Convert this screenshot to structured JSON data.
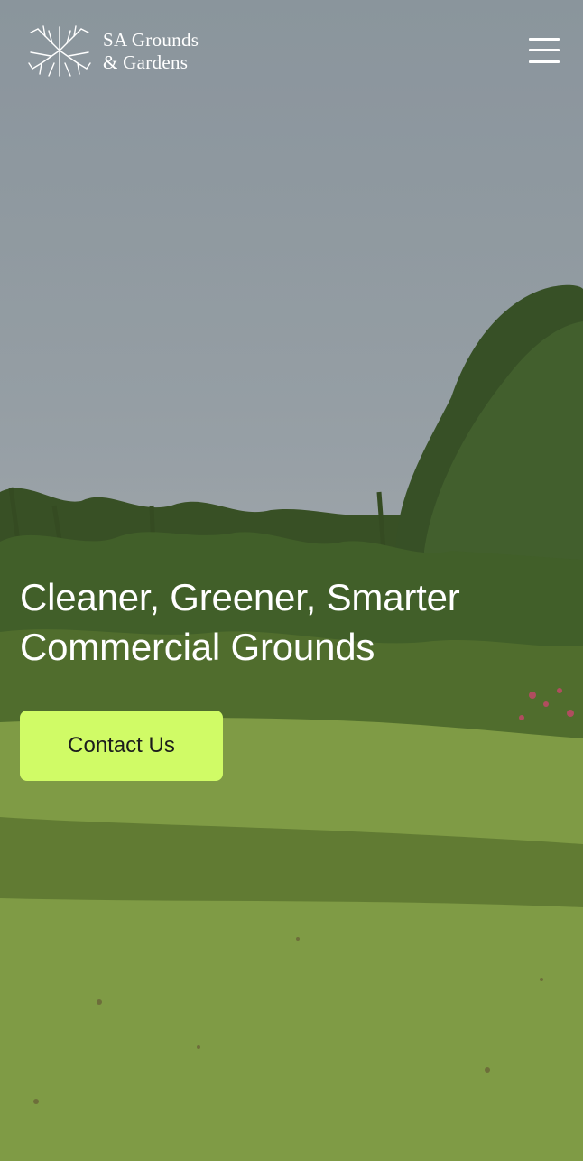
{
  "brand": {
    "name_line1": "SA Grounds",
    "name_line2": "& Gardens",
    "logo_icon": "tree-roots-icon"
  },
  "nav": {
    "menu_icon": "hamburger-menu-icon"
  },
  "hero": {
    "headline_line1": "Cleaner, Greener, Smarter",
    "headline_line2": "Commercial Grounds",
    "cta_label": "Contact Us",
    "cta_color": "#d0fb66",
    "background_image": "golf-course-lawn-with-trees"
  }
}
